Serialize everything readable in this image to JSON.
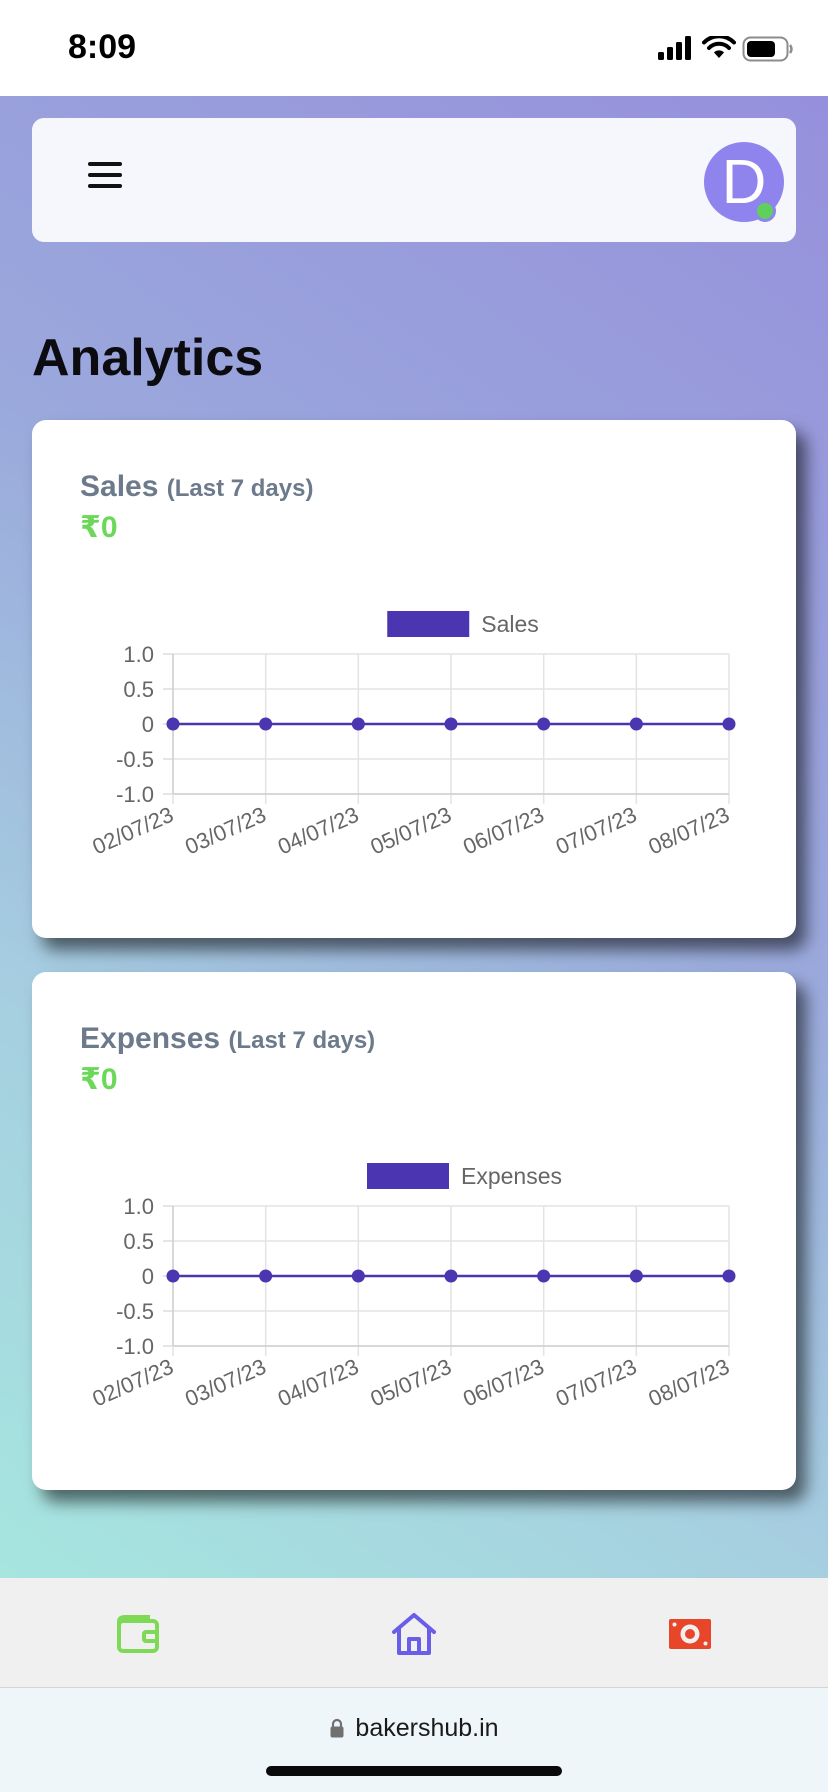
{
  "status_bar": {
    "time": "8:09"
  },
  "header": {
    "avatar_letter": "D"
  },
  "page": {
    "title": "Analytics"
  },
  "cards": [
    {
      "title": "Sales",
      "subtitle": "(Last 7 days)",
      "amount": "₹0"
    },
    {
      "title": "Expenses",
      "subtitle": "(Last 7 days)",
      "amount": "₹0"
    }
  ],
  "chart_data": [
    {
      "type": "line",
      "categories": [
        "02/07/23",
        "03/07/23",
        "04/07/23",
        "05/07/23",
        "06/07/23",
        "07/07/23",
        "08/07/23"
      ],
      "series": [
        {
          "name": "Sales",
          "values": [
            0,
            0,
            0,
            0,
            0,
            0,
            0
          ]
        }
      ],
      "y_ticks": [
        "1.0",
        "0.5",
        "0",
        "-0.5",
        "-1.0"
      ],
      "ylim": [
        -1,
        1
      ],
      "grid": true,
      "legend": "top-center",
      "color": "#4b35b0"
    },
    {
      "type": "line",
      "categories": [
        "02/07/23",
        "03/07/23",
        "04/07/23",
        "05/07/23",
        "06/07/23",
        "07/07/23",
        "08/07/23"
      ],
      "series": [
        {
          "name": "Expenses",
          "values": [
            0,
            0,
            0,
            0,
            0,
            0,
            0
          ]
        }
      ],
      "y_ticks": [
        "1.0",
        "0.5",
        "0",
        "-0.5",
        "-1.0"
      ],
      "ylim": [
        -1,
        1
      ],
      "grid": true,
      "legend": "top-center",
      "color": "#4b35b0"
    }
  ],
  "tab_bar": {
    "items": [
      {
        "icon": "wallet-icon",
        "color": "#7ed957"
      },
      {
        "icon": "home-icon",
        "color": "#6a5ee8"
      },
      {
        "icon": "cash-icon",
        "color": "#e8462a"
      }
    ]
  },
  "url_bar": {
    "url": "bakershub.in"
  }
}
